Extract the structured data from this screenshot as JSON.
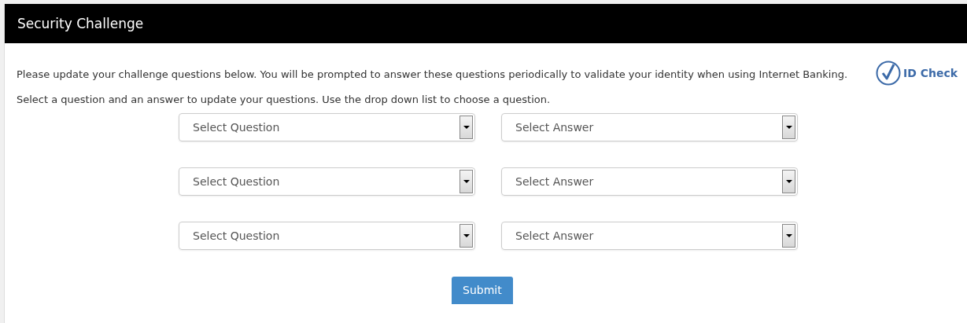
{
  "panel": {
    "title": "Security Challenge"
  },
  "intro": "Please update your challenge questions below. You will be prompted to answer these questions periodically to validate your identity when using Internet Banking.",
  "badge": {
    "label": "ID Check"
  },
  "instruction": "Select a question and an answer to update your questions. Use the drop down list to choose a question.",
  "rows": [
    {
      "question": {
        "placeholder": "Select Question"
      },
      "answer": {
        "placeholder": "Select Answer"
      }
    },
    {
      "question": {
        "placeholder": "Select Question"
      },
      "answer": {
        "placeholder": "Select Answer"
      }
    },
    {
      "question": {
        "placeholder": "Select Question"
      },
      "answer": {
        "placeholder": "Select Answer"
      }
    }
  ],
  "submit": "Submit"
}
